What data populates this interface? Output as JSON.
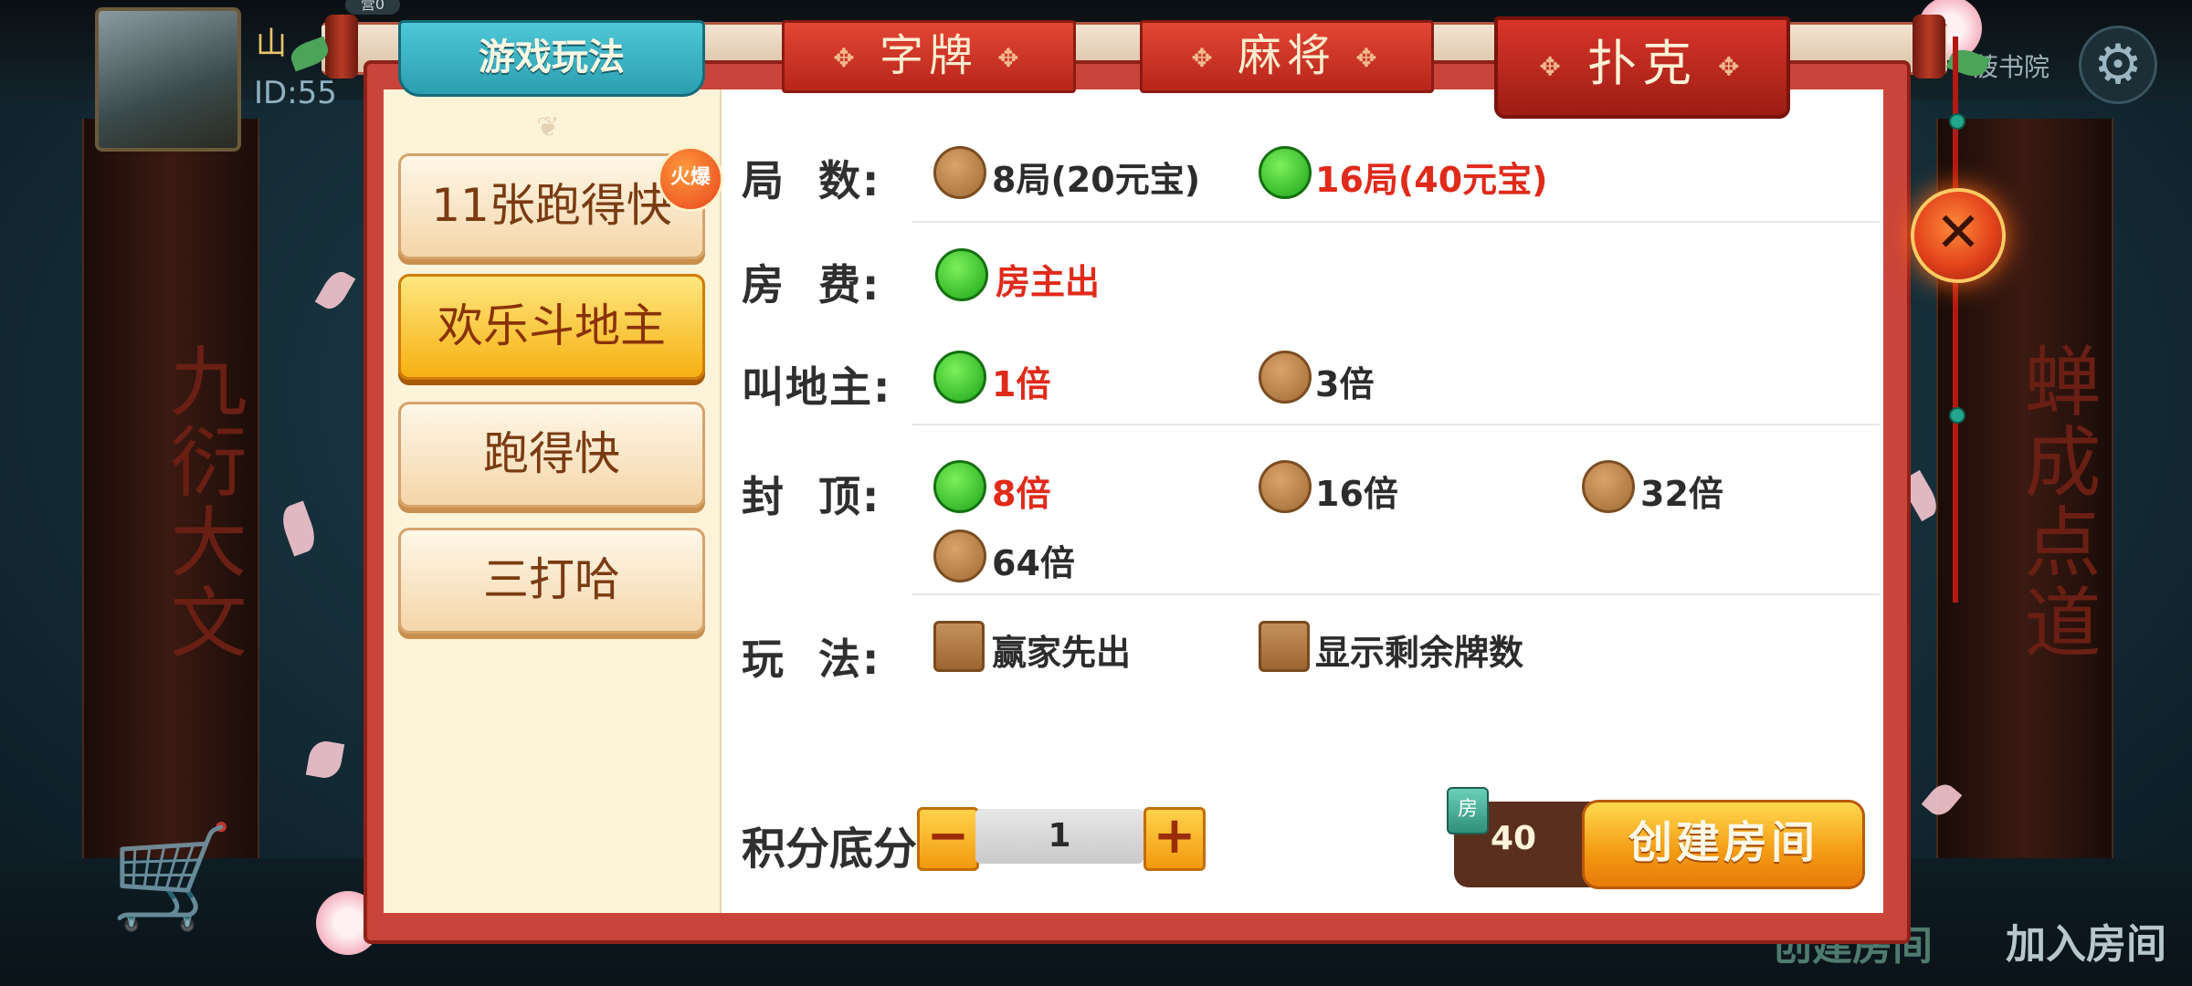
{
  "player": {
    "name": "山",
    "id": "ID:55",
    "badge": "营0"
  },
  "top_right": {
    "label": "菠书院"
  },
  "background": {
    "pillar_left": "九衍大文",
    "pillar_right": "蝉成点道",
    "bottom_items": [
      "创建房间",
      "加入房间"
    ]
  },
  "tabs": {
    "main": "游戏玩法",
    "items": [
      "字牌",
      "麻将",
      "扑克"
    ],
    "active": "扑克"
  },
  "games": [
    {
      "label": "11张跑得快",
      "hot": "火爆"
    },
    {
      "label": "欢乐斗地主",
      "active": true
    },
    {
      "label": "跑得快"
    },
    {
      "label": "三打哈"
    }
  ],
  "options": {
    "rounds": {
      "label": "局  数:",
      "choices": [
        {
          "text": "8局(20元宝)",
          "selected": false
        },
        {
          "text": "16局(40元宝)",
          "selected": true
        }
      ]
    },
    "fee": {
      "label": "房  费:",
      "choices": [
        {
          "text": "房主出",
          "selected": true
        }
      ]
    },
    "landlord": {
      "label": "叫地主:",
      "choices": [
        {
          "text": "1倍",
          "selected": true
        },
        {
          "text": "3倍",
          "selected": false
        }
      ]
    },
    "cap": {
      "label": "封  顶:",
      "choices": [
        {
          "text": "8倍",
          "selected": true
        },
        {
          "text": "16倍",
          "selected": false
        },
        {
          "text": "32倍",
          "selected": false
        },
        {
          "text": "64倍",
          "selected": false
        }
      ]
    },
    "rules": {
      "label": "玩  法:",
      "choices": [
        {
          "text": "赢家先出",
          "checked": false
        },
        {
          "text": "显示剩余牌数",
          "checked": false
        }
      ]
    }
  },
  "score": {
    "label": "积分底分",
    "value": "1",
    "minus": "−",
    "plus": "+"
  },
  "create": {
    "cost_icon": "房",
    "cost": "40",
    "button": "创建房间"
  },
  "close": {
    "icon": "close-icon",
    "glyph": "✕"
  },
  "colors": {
    "accent_red": "#c9443a",
    "selected_green": "#1da51a",
    "button_orange": "#f39a12",
    "tab_teal": "#2a9fb1"
  }
}
